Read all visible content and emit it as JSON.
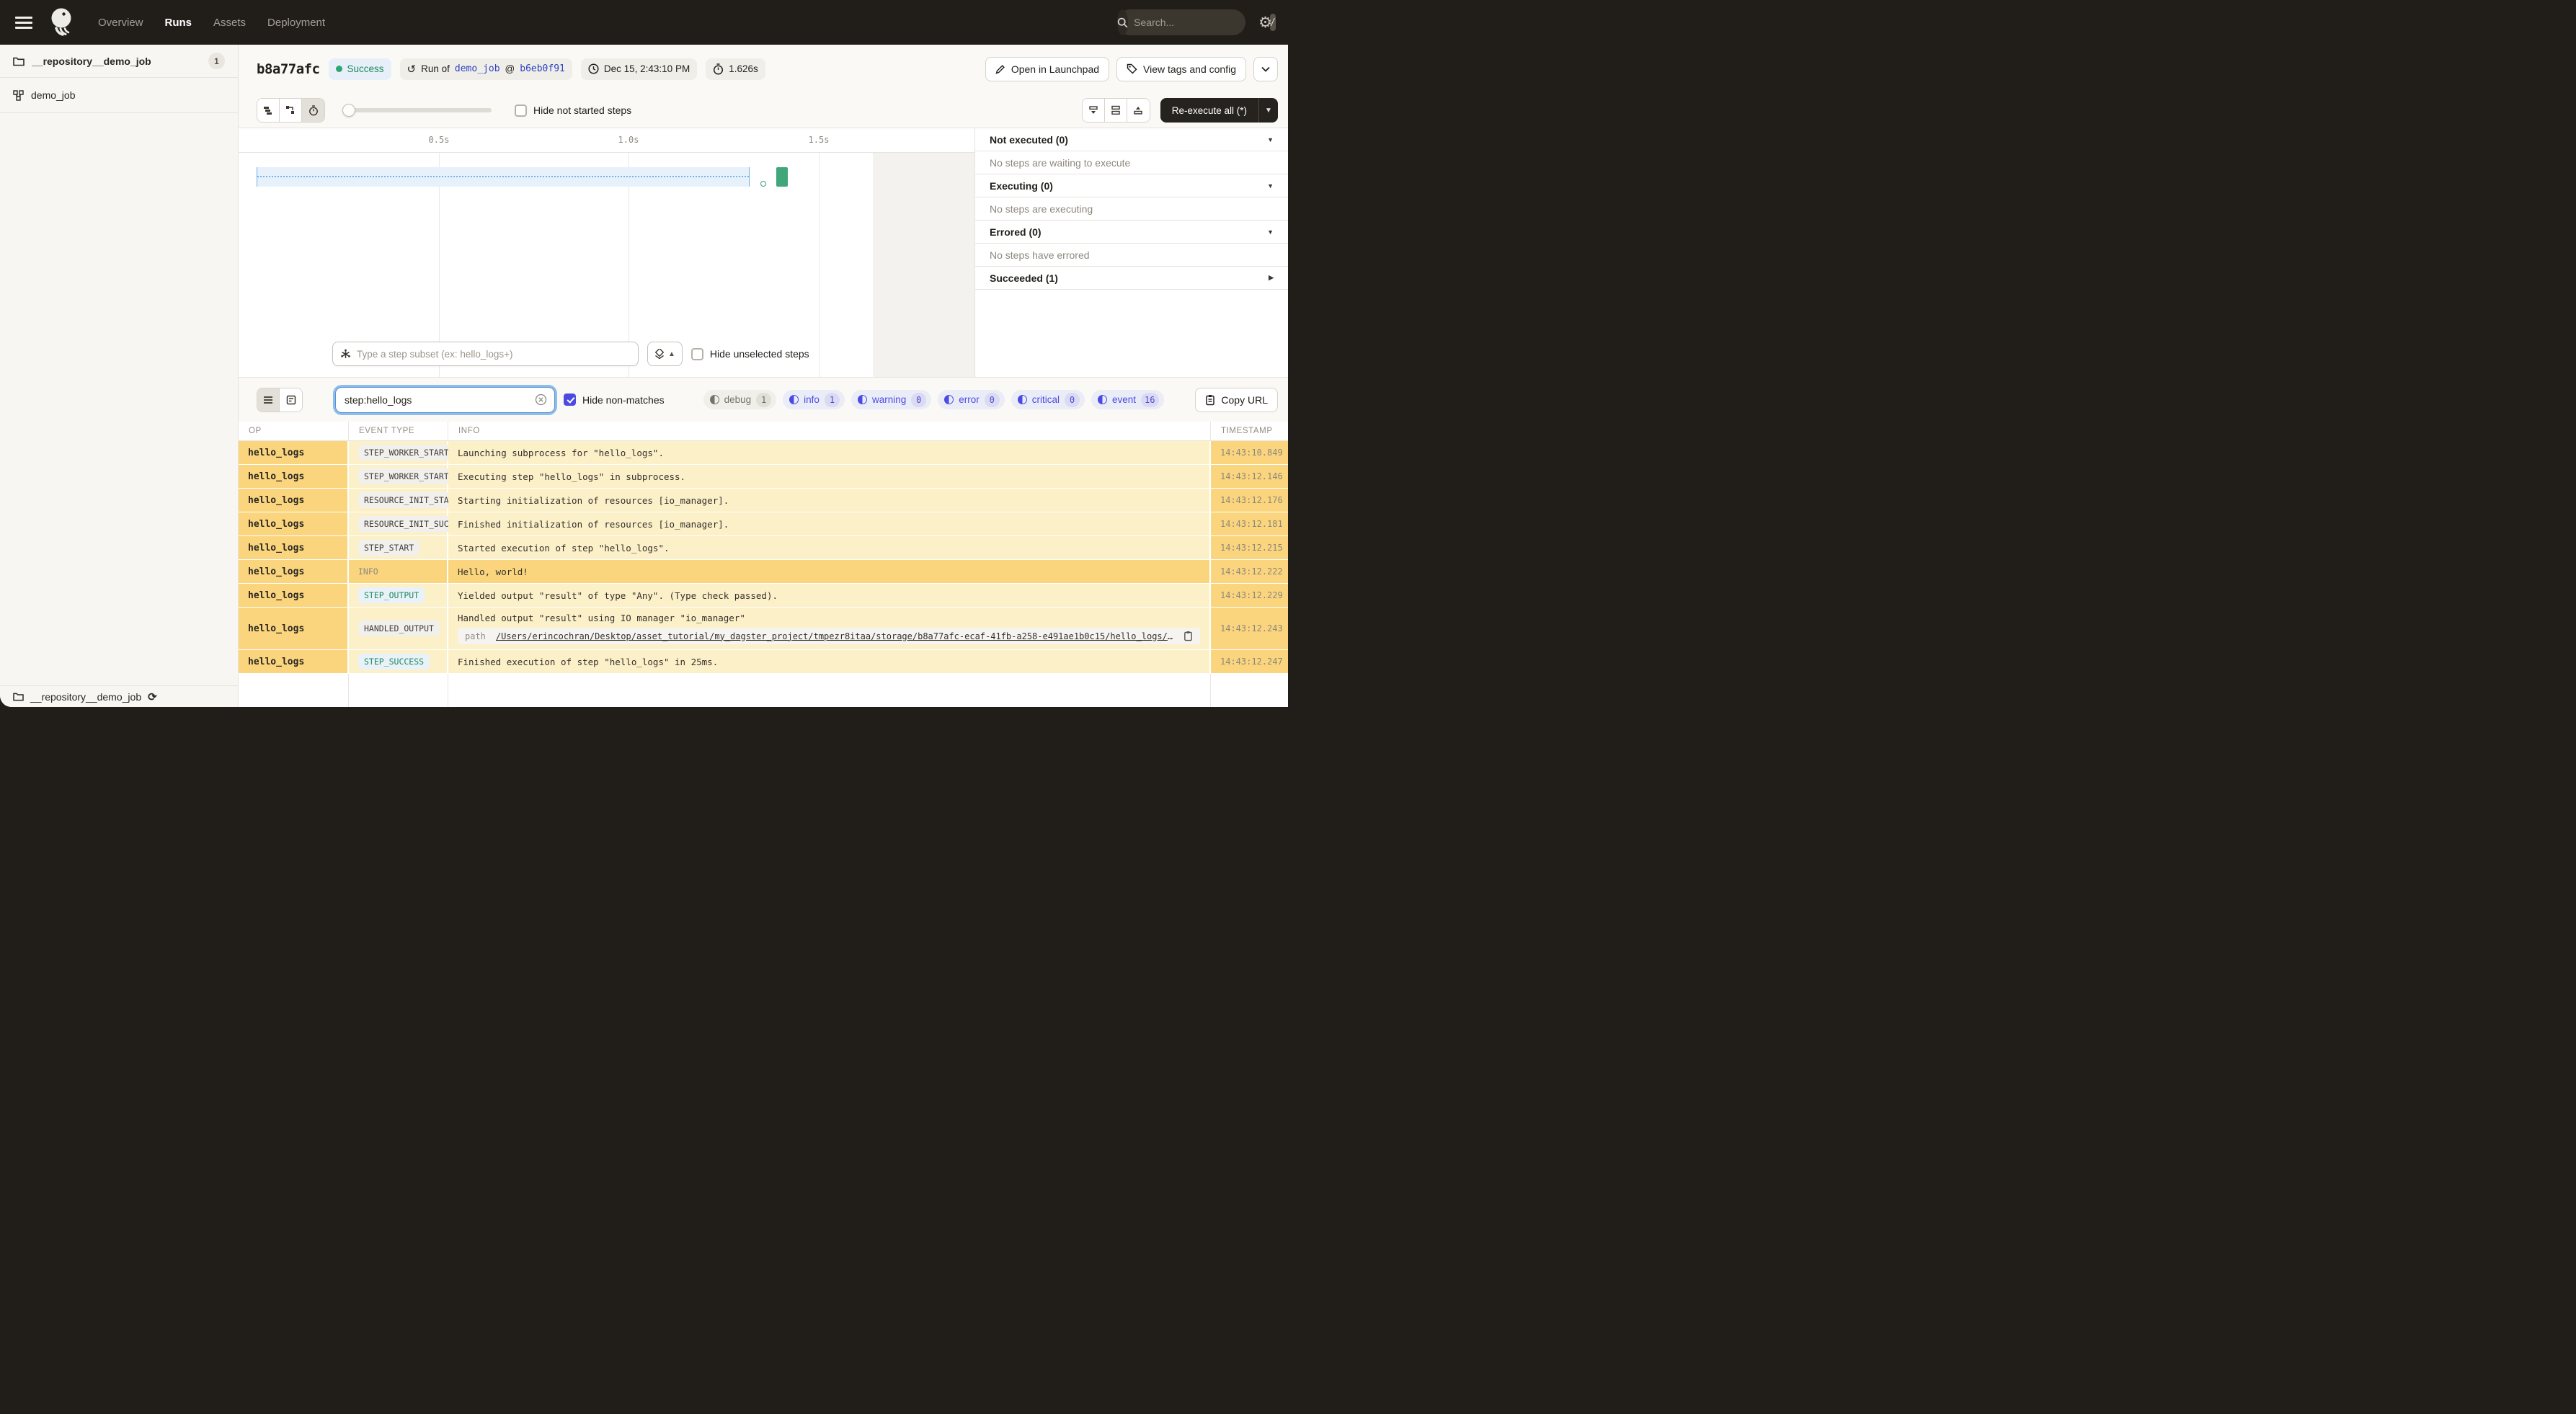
{
  "colors": {
    "accent": "#4B4BE1",
    "link": "#2D43C0",
    "success": "#1E8A5E",
    "highlight": "#FAD57E",
    "highlight_soft": "#FCF0C9",
    "nav_bg": "#211E1A"
  },
  "nav": {
    "items": [
      "Overview",
      "Runs",
      "Assets",
      "Deployment"
    ],
    "active": "Runs",
    "search_placeholder": "Search...",
    "search_shortcut": "/"
  },
  "sidebar": {
    "repo": {
      "name": "__repository__demo_job",
      "count": "1"
    },
    "job": {
      "name": "demo_job"
    },
    "footer": {
      "name": "__repository__demo_job"
    }
  },
  "run_header": {
    "run_id": "b8a77afc",
    "status": "Success",
    "run_of_label": "Run of",
    "job_link": "demo_job",
    "at_sign": "@",
    "commit_link": "b6eb0f91",
    "datetime": "Dec 15, 2:43:10 PM",
    "duration": "1.626s",
    "open_launchpad": "Open in Launchpad",
    "view_tags": "View tags and config"
  },
  "toolbar": {
    "hide_not_started": "Hide not started steps",
    "reexecute_label": "Re-execute all (*)"
  },
  "gantt": {
    "ticks": [
      "0.5s",
      "1.0s",
      "1.5s"
    ],
    "subset_placeholder": "Type a step subset (ex: hello_logs+)",
    "hide_unselected": "Hide unselected steps"
  },
  "steps_panel": {
    "sections": [
      {
        "title": "Not executed (0)",
        "body": "No steps are waiting to execute",
        "expanded": true
      },
      {
        "title": "Executing (0)",
        "body": "No steps are executing",
        "expanded": true
      },
      {
        "title": "Errored (0)",
        "body": "No steps have errored",
        "expanded": true
      },
      {
        "title": "Succeeded (1)",
        "body": "",
        "expanded": false
      }
    ]
  },
  "log_filter": {
    "value": "step:hello_logs",
    "hide_non_matches": "Hide non-matches",
    "levels": [
      {
        "label": "debug",
        "count": "1",
        "enabled": false
      },
      {
        "label": "info",
        "count": "1",
        "enabled": true
      },
      {
        "label": "warning",
        "count": "0",
        "enabled": true
      },
      {
        "label": "error",
        "count": "0",
        "enabled": true
      },
      {
        "label": "critical",
        "count": "0",
        "enabled": true
      },
      {
        "label": "event",
        "count": "16",
        "enabled": true
      }
    ],
    "copy_url": "Copy URL"
  },
  "log_table": {
    "columns": [
      "OP",
      "EVENT TYPE",
      "INFO",
      "TIMESTAMP"
    ],
    "rows": [
      {
        "op": "hello_logs",
        "event_type": "STEP_WORKER_STARTI…",
        "chip": "gray",
        "info": "Launching subprocess for \"hello_logs\".",
        "timestamp": "14:43:10.849",
        "highlight": false
      },
      {
        "op": "hello_logs",
        "event_type": "STEP_WORKER_STARTED",
        "chip": "gray",
        "info": "Executing step \"hello_logs\" in subprocess.",
        "timestamp": "14:43:12.146",
        "highlight": false
      },
      {
        "op": "hello_logs",
        "event_type": "RESOURCE_INIT_STAR…",
        "chip": "gray",
        "info": "Starting initialization of resources [io_manager].",
        "timestamp": "14:43:12.176",
        "highlight": false
      },
      {
        "op": "hello_logs",
        "event_type": "RESOURCE_INIT_SUCC…",
        "chip": "gray",
        "info": "Finished initialization of resources [io_manager].",
        "timestamp": "14:43:12.181",
        "highlight": false
      },
      {
        "op": "hello_logs",
        "event_type": "STEP_START",
        "chip": "gray",
        "info": "Started execution of step \"hello_logs\".",
        "timestamp": "14:43:12.215",
        "highlight": false
      },
      {
        "op": "hello_logs",
        "event_type": "INFO",
        "chip": "plain",
        "info": "Hello, world!",
        "timestamp": "14:43:12.222",
        "highlight": true
      },
      {
        "op": "hello_logs",
        "event_type": "STEP_OUTPUT",
        "chip": "green",
        "info": "Yielded output \"result\" of type \"Any\". (Type check passed).",
        "timestamp": "14:43:12.229",
        "highlight": false
      },
      {
        "op": "hello_logs",
        "event_type": "HANDLED_OUTPUT",
        "chip": "gray",
        "info": "Handled output \"result\" using IO manager \"io_manager\"",
        "timestamp": "14:43:12.243",
        "highlight": false,
        "path": {
          "label": "path",
          "value": "/Users/erincochran/Desktop/asset_tutorial/my_dagster_project/tmpezr8itaa/storage/b8a77afc-ecaf-41fb-a258-e491ae1b0c15/hello_logs/result"
        }
      },
      {
        "op": "hello_logs",
        "event_type": "STEP_SUCCESS",
        "chip": "green",
        "info": "Finished execution of step \"hello_logs\" in 25ms.",
        "timestamp": "14:43:12.247",
        "highlight": false
      }
    ]
  }
}
